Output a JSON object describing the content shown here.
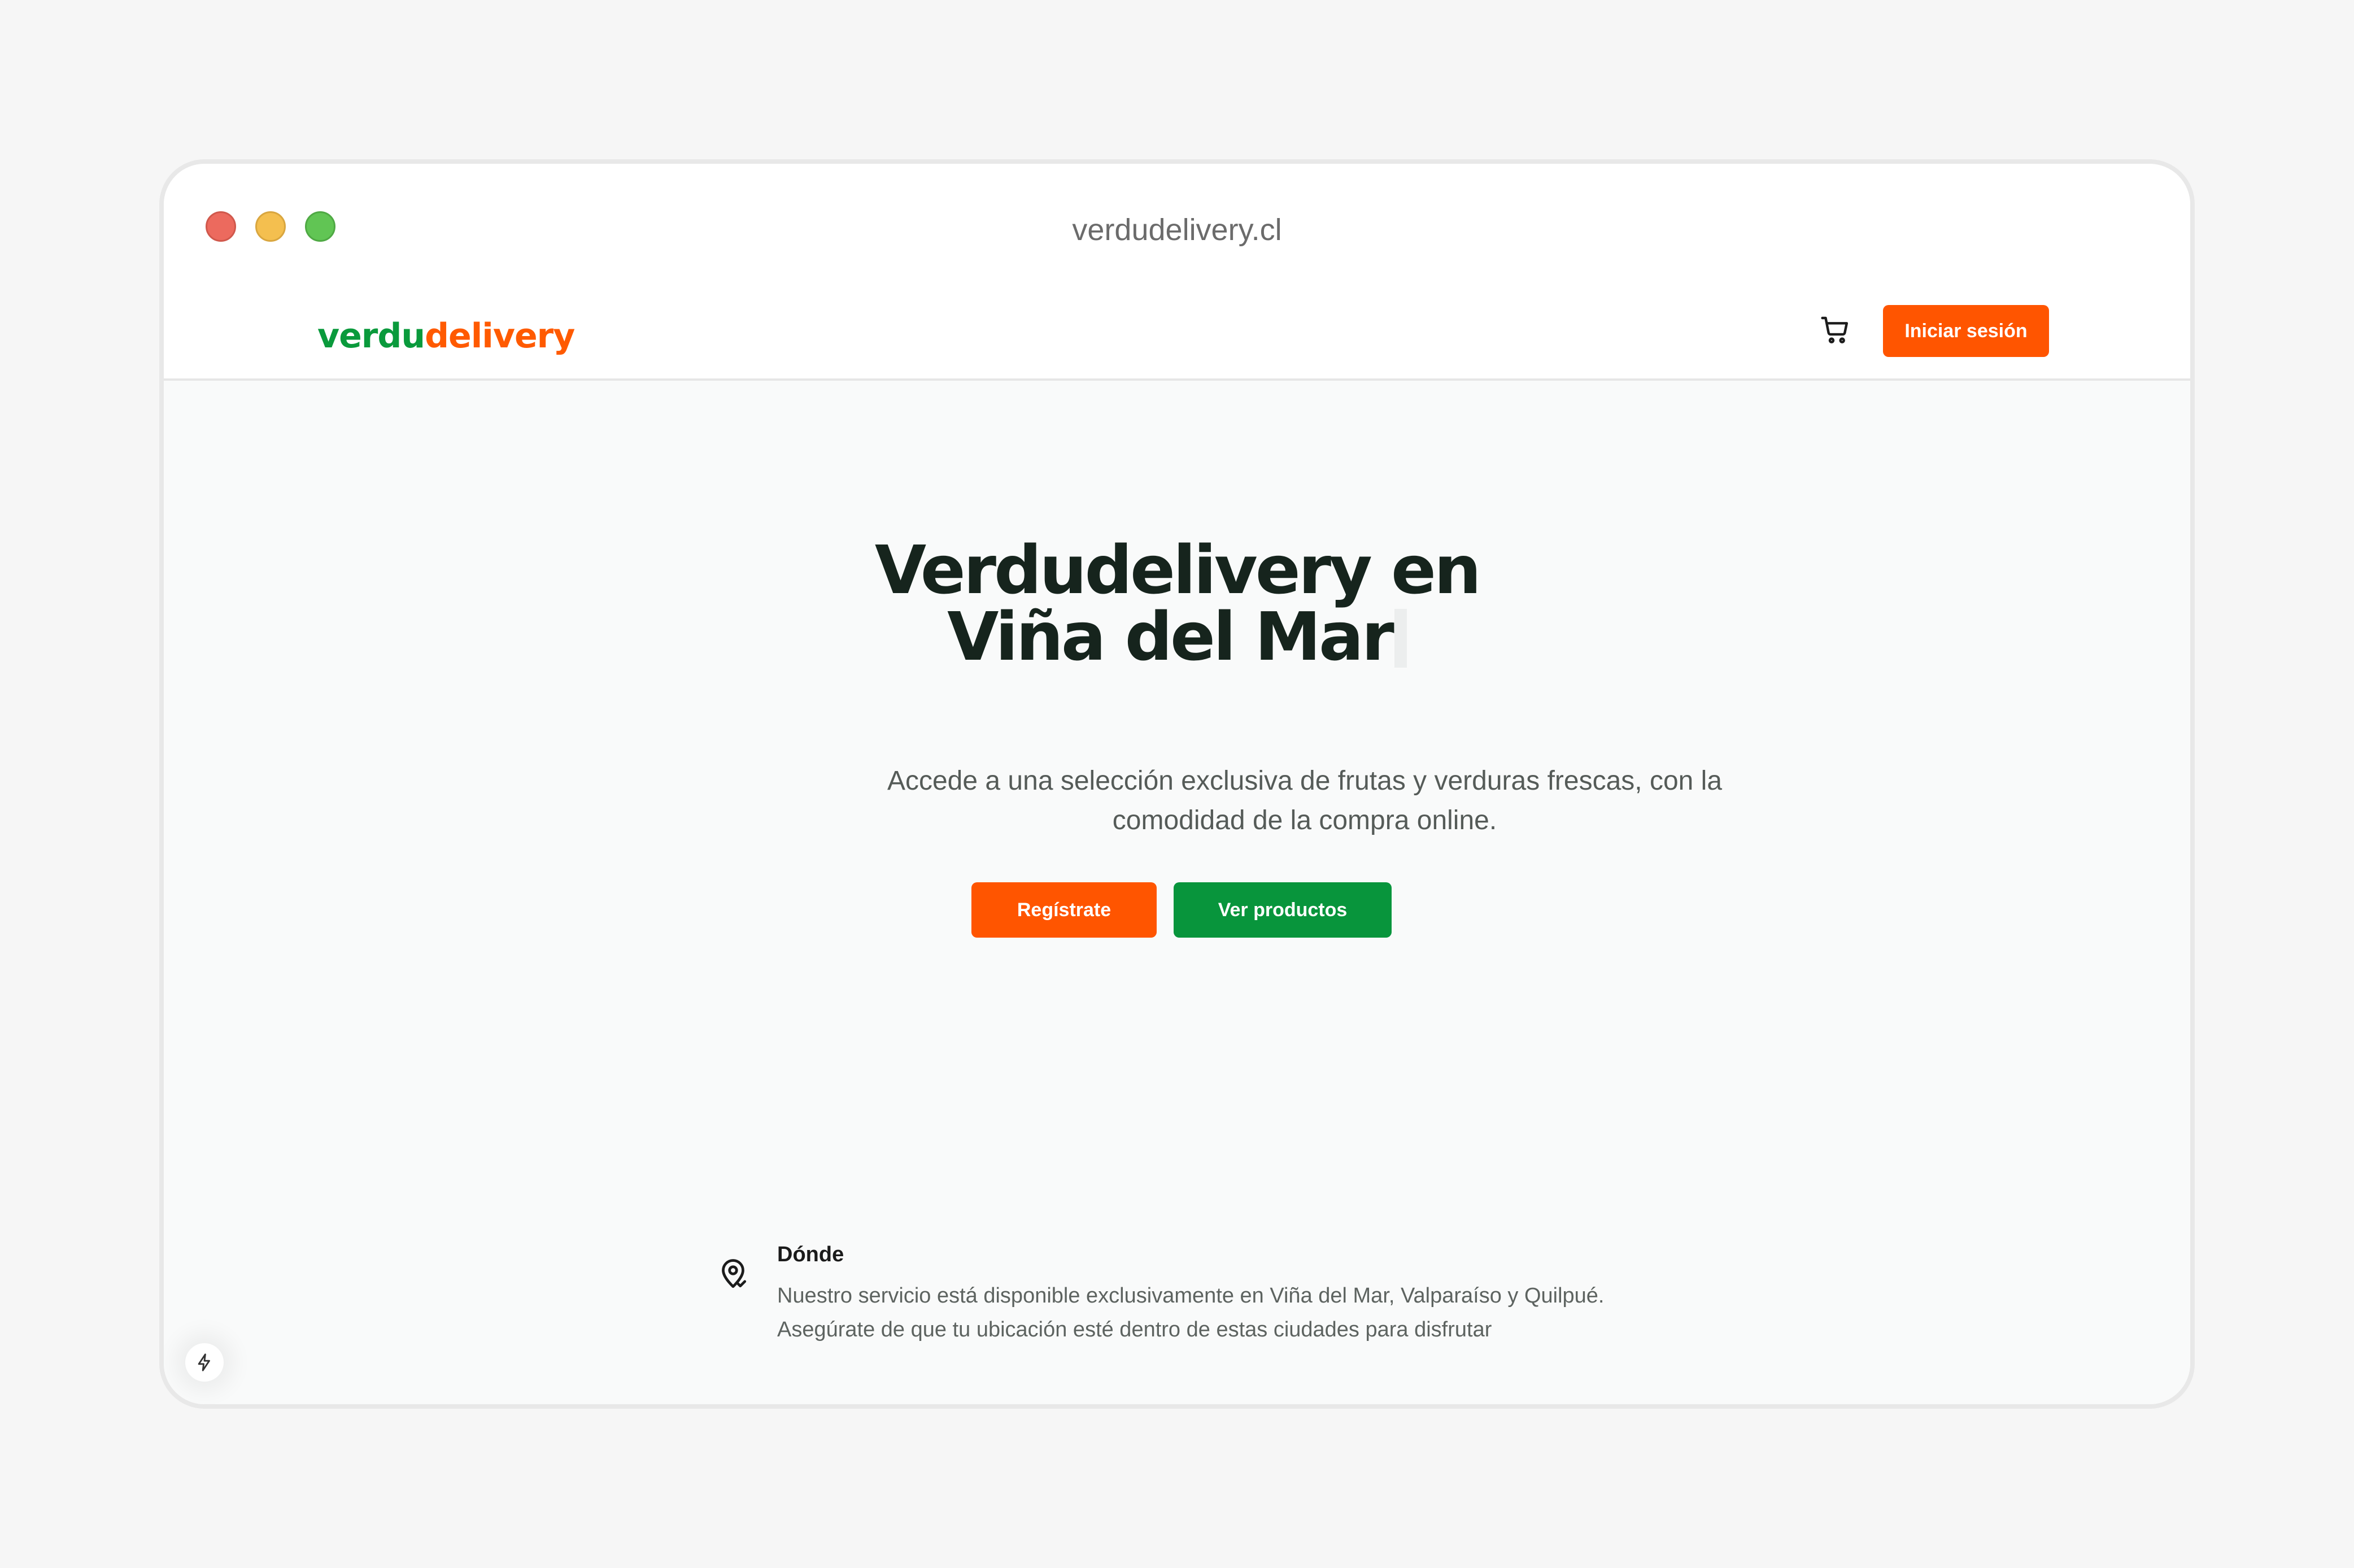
{
  "window": {
    "url": "verdudelivery.cl"
  },
  "nav": {
    "logo_part1": "verdu",
    "logo_part2": "delivery",
    "login_label": "Iniciar sesión"
  },
  "hero": {
    "title_line1": "Verdudelivery en",
    "title_line2": "Viña del Mar",
    "subtitle": "Accede a una selección exclusiva de frutas y verduras frescas, con la comodidad de la compra online.",
    "register_label": "Regístrate",
    "products_label": "Ver productos"
  },
  "feature": {
    "title": "Dónde",
    "text": "Nuestro servicio está disponible exclusivamente en Viña del Mar, Valparaíso y Quilpué. Asegúrate de que tu ubicación esté dentro de estas ciudades para disfrutar"
  },
  "icons": {
    "cart": "cart-icon",
    "location": "map-pin-check-icon",
    "bolt": "bolt-icon"
  },
  "colors": {
    "brand_green": "#0a9a3c",
    "brand_orange": "#ff5500",
    "heading": "#16241d"
  }
}
